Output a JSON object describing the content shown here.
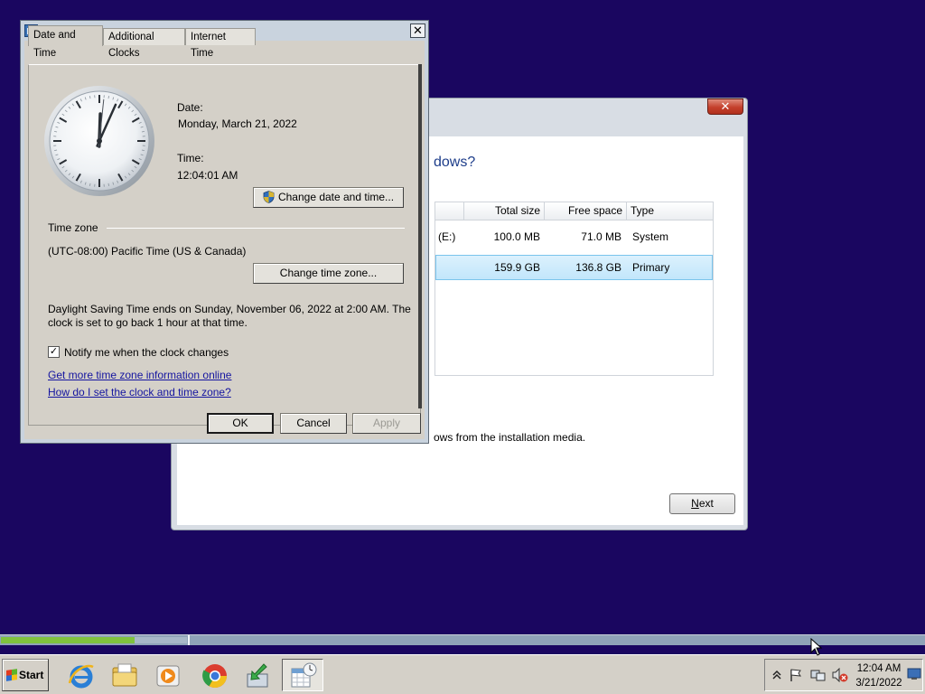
{
  "setup_window": {
    "heading": "dows?",
    "columns": [
      "Total size",
      "Free space",
      "Type"
    ],
    "rows": [
      {
        "name": "(E:)",
        "total": "100.0 MB",
        "free": "71.0 MB",
        "type": "System"
      },
      {
        "name": "",
        "total": "159.9 GB",
        "free": "136.8 GB",
        "type": "Primary"
      }
    ],
    "note": "ows from the installation media.",
    "next_label_underlined": "N",
    "next_label_rest": "ext",
    "close_glyph": "✕"
  },
  "dialog": {
    "title": "Date and Time",
    "close_glyph": "✕",
    "tabs": [
      "Date and Time",
      "Additional Clocks",
      "Internet Time"
    ],
    "date_label": "Date:",
    "date_value": "Monday, March 21, 2022",
    "time_label": "Time:",
    "time_value": "12:04:01 AM",
    "change_datetime_button": "Change date and time...",
    "timezone_heading": "Time zone",
    "timezone_value": "(UTC-08:00) Pacific Time (US & Canada)",
    "change_timezone_button": "Change time zone...",
    "dst_line1": "Daylight Saving Time ends on Sunday, November 06, 2022 at 2:00 AM. The",
    "dst_line2": "clock is set to go back 1 hour at that time.",
    "notify_label": "Notify me when the clock changes",
    "notify_checked": true,
    "link_more_info": "Get more time zone information online",
    "link_how_to": "How do I set the clock and time zone?",
    "ok_label": "OK",
    "cancel_label": "Cancel",
    "apply_label": "Apply",
    "clock_time": {
      "hours": 12,
      "minutes": 4,
      "seconds": 1
    }
  },
  "taskbar": {
    "start_label": "Start",
    "apps": [
      "internet-explorer",
      "windows-explorer",
      "media-player",
      "chrome",
      "installer",
      "date-time"
    ],
    "active_app": "date-time",
    "tray_time": "12:04 AM",
    "tray_date": "3/21/2022",
    "progress_fraction": 0.145
  },
  "colors": {
    "desktop": "#1a0660",
    "progress": "#7fc23e",
    "selection": "#c2e6fb",
    "link": "#1515a0"
  }
}
